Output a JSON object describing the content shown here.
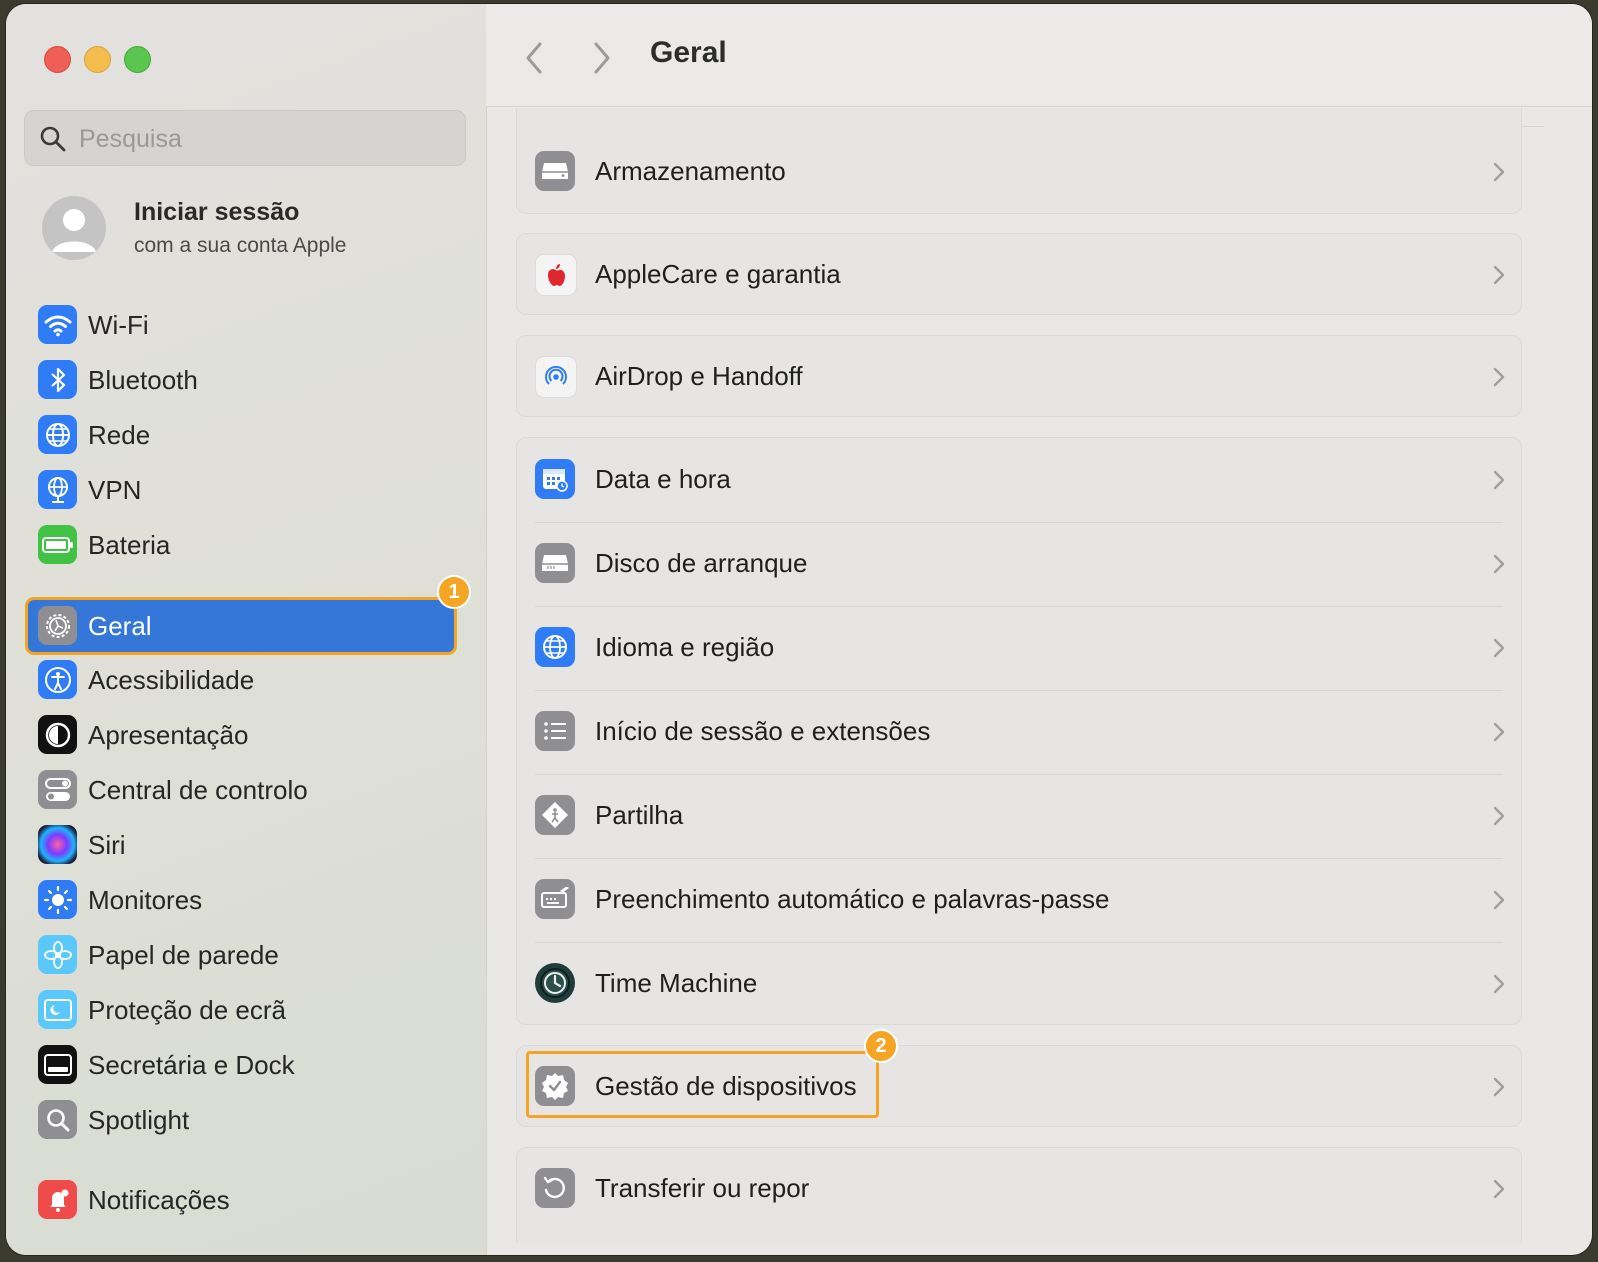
{
  "window": {
    "title": "Geral"
  },
  "sidebar": {
    "search_placeholder": "Pesquisa",
    "account": {
      "name": "Iniciar sessão",
      "subtitle": "com a sua conta Apple"
    },
    "items": [
      {
        "label": "Wi-Fi",
        "icon": "wifi-icon",
        "color": "#2f7cf6"
      },
      {
        "label": "Bluetooth",
        "icon": "bluetooth-icon",
        "color": "#2f7cf6"
      },
      {
        "label": "Rede",
        "icon": "globe-network-icon",
        "color": "#2f7cf6"
      },
      {
        "label": "VPN",
        "icon": "vpn-globe-icon",
        "color": "#2f7cf6"
      },
      {
        "label": "Bateria",
        "icon": "battery-icon",
        "color": "#42c245"
      },
      {
        "label": "Geral",
        "icon": "gear-icon",
        "color": "#8e8e93"
      },
      {
        "label": "Acessibilidade",
        "icon": "accessibility-icon",
        "color": "#2f7cf6"
      },
      {
        "label": "Apresentação",
        "icon": "appearance-icon",
        "color": "#111111"
      },
      {
        "label": "Central de controlo",
        "icon": "control-center-icon",
        "color": "#8e8e93"
      },
      {
        "label": "Siri",
        "icon": "siri-icon",
        "color": "#1c1c3a"
      },
      {
        "label": "Monitores",
        "icon": "sun-icon",
        "color": "#2f7cf6"
      },
      {
        "label": "Papel de parede",
        "icon": "flower-icon",
        "color": "#5ac8fa"
      },
      {
        "label": "Proteção de ecrã",
        "icon": "screensaver-icon",
        "color": "#5ac8fa"
      },
      {
        "label": "Secretária e Dock",
        "icon": "dock-icon",
        "color": "#111111"
      },
      {
        "label": "Spotlight",
        "icon": "magnifier-icon",
        "color": "#8e8e93"
      },
      {
        "label": "Notificações",
        "icon": "bell-icon",
        "color": "#ef4b4b"
      }
    ],
    "active_item": "Geral",
    "badge_1": "1"
  },
  "main": {
    "title": "Geral",
    "rows": [
      {
        "label": "Armazenamento",
        "icon": "drive-icon"
      },
      {
        "label": "AppleCare e garantia",
        "icon": "apple-icon"
      },
      {
        "label": "AirDrop e Handoff",
        "icon": "airdrop-icon"
      },
      {
        "label": "Data e hora",
        "icon": "calendar-clock-icon"
      },
      {
        "label": "Disco de arranque",
        "icon": "disk-icon"
      },
      {
        "label": "Idioma e região",
        "icon": "globe-icon"
      },
      {
        "label": "Início de sessão e extensões",
        "icon": "list-icon"
      },
      {
        "label": "Partilha",
        "icon": "sharing-icon"
      },
      {
        "label": "Preenchimento automático e palavras-passe",
        "icon": "autofill-icon"
      },
      {
        "label": "Time Machine",
        "icon": "time-machine-icon"
      },
      {
        "label": "Gestão de dispositivos",
        "icon": "device-management-icon"
      },
      {
        "label": "Transferir ou repor",
        "icon": "reset-icon"
      }
    ],
    "badge_2": "2"
  },
  "colors": {
    "accent": "#3477d8",
    "highlight": "#f5a523"
  }
}
